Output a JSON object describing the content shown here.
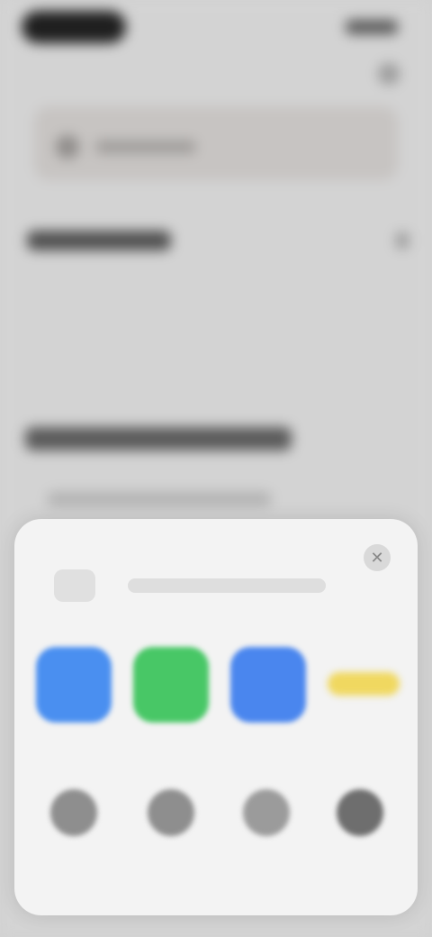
{
  "share_sheet": {
    "close_glyph": "✕",
    "apps": [
      {
        "icon": "blue-app-icon",
        "color": "#4a8ff0"
      },
      {
        "icon": "green-app-icon",
        "color": "#48c766"
      },
      {
        "icon": "blue-app-icon",
        "color": "#4a86ee"
      },
      {
        "icon": "yellow-app-icon",
        "color": "#f0d860"
      }
    ],
    "actions": [
      {
        "icon": "gray-circle-icon",
        "color": "#8e8e8e"
      },
      {
        "icon": "gray-circle-icon",
        "color": "#8e8e8e"
      },
      {
        "icon": "gray-circle-icon",
        "color": "#9b9b9b"
      },
      {
        "icon": "gray-circle-icon",
        "color": "#6e6e6e"
      }
    ]
  }
}
